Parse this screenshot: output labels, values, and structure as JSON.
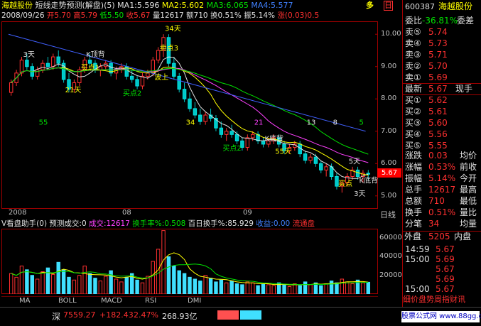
{
  "title": {
    "name": "海越股份",
    "indicator": "短线走势预测(解盘)(5)",
    "ma1": "MA1:5.596",
    "ma2": "MA2:5.602",
    "ma3": "MA3:6.065",
    "ma4": "MA4:5.577",
    "dir": "多",
    "day_label": "日"
  },
  "info": {
    "date": "2008/09/26",
    "open": "开5.70",
    "high": "高5.79",
    "low": "低5.50",
    "close": "收5.67",
    "volume": "量12617",
    "amount": "额710",
    "turnover": "换0.51%",
    "amplitude": "振5.14%",
    "change": "涨(0.03)0.5"
  },
  "price_axis": [
    "10.00",
    "9.00",
    "8.00",
    "7.00",
    "6.00",
    "5.00"
  ],
  "current_price": "5.67",
  "annotations": [
    {
      "text": "3天",
      "cls": "wht"
    },
    {
      "text": "21天",
      "cls": "yel"
    },
    {
      "text": "34天",
      "cls": "yel"
    },
    {
      "text": "K顶背",
      "cls": "wht"
    },
    {
      "text": "波上",
      "cls": "yel"
    },
    {
      "text": "K底背",
      "cls": "wht"
    },
    {
      "text": "55天",
      "cls": "yel"
    },
    {
      "text": "5天",
      "cls": "wht"
    },
    {
      "text": "K底背",
      "cls": "wht"
    },
    {
      "text": "3天",
      "cls": "wht"
    },
    {
      "text": "55",
      "cls": "grn"
    },
    {
      "text": "34",
      "cls": "yel"
    },
    {
      "text": "21",
      "cls": "mag"
    },
    {
      "text": "13",
      "cls": "wht"
    },
    {
      "text": "8",
      "cls": "wht"
    },
    {
      "text": "5",
      "cls": "grn"
    },
    {
      "text": "买点1",
      "cls": "yel"
    },
    {
      "text": "买点2",
      "cls": "grn"
    },
    {
      "text": "卖点3",
      "cls": "yel"
    },
    {
      "text": "买点2",
      "cls": "grn"
    },
    {
      "text": "买点",
      "cls": "yel"
    }
  ],
  "time_axis": [
    "2008",
    "08",
    "09",
    "日线"
  ],
  "volume_header": {
    "name": "V看盘助手(0)",
    "pred": "预测成交:0",
    "vol": "成交:12617",
    "turn": "换手率%:0.508",
    "hundred": "百日换手%:85.929",
    "gain": "收益:0.00",
    "flow": "流通盘"
  },
  "volume_axis": [
    "60000",
    "40000",
    "20000"
  ],
  "tabs": [
    "MA",
    "BOLL",
    "MACD",
    "RSI",
    "DMI"
  ],
  "index_bar": {
    "name": "深",
    "value": "7559.27",
    "change": "+182.43",
    "pct": "2.47%",
    "amount": "268.93亿"
  },
  "watermark": "股票公式网 www.88gg.com",
  "right_panel": {
    "code": "600387",
    "name": "海越股份",
    "ratio_label": "委比",
    "ratio": "-36.81%",
    "diff_label": "委差",
    "sells": [
      {
        "label": "卖⑤",
        "price": "5.74"
      },
      {
        "label": "卖④",
        "price": "5.73"
      },
      {
        "label": "卖③",
        "price": "5.71"
      },
      {
        "label": "卖②",
        "price": "5.70"
      },
      {
        "label": "卖①",
        "price": "5.69"
      }
    ],
    "latest_label": "最新",
    "latest": "5.67",
    "xianshou": "现手",
    "buys": [
      {
        "label": "买①",
        "price": "5.62"
      },
      {
        "label": "买②",
        "price": "5.61"
      },
      {
        "label": "买③",
        "price": "5.60"
      },
      {
        "label": "买④",
        "price": "5.56"
      },
      {
        "label": "买⑤",
        "price": "5.55"
      }
    ],
    "stats": [
      {
        "l": "涨跌",
        "v": "0.03",
        "r": "均价"
      },
      {
        "l": "涨幅",
        "v": "0.53%",
        "r": "前收"
      },
      {
        "l": "振幅",
        "v": "5.14%",
        "r": "今开"
      },
      {
        "l": "总手",
        "v": "12617",
        "r": "最高"
      },
      {
        "l": "总额",
        "v": "710",
        "r": "最低"
      },
      {
        "l": "换手",
        "v": "0.51%",
        "r": "量比"
      },
      {
        "l": "分笔",
        "v": "34",
        "r": "均量"
      }
    ],
    "outer_label": "外盘",
    "outer": "5205",
    "inner_label": "内盘",
    "ticks": [
      {
        "t": "14:59",
        "p": "5.67"
      },
      {
        "t": "15:00",
        "p": "5.69"
      },
      {
        "t": "",
        "p": "5.67"
      },
      {
        "t": "",
        "p": "5.69"
      },
      {
        "t": "15:00",
        "p": "5.67"
      }
    ],
    "bottom_tabs": "细价盘势周指财讯"
  },
  "chart_data": {
    "type": "bar",
    "title": "",
    "candles": [
      [
        8.2,
        8.6,
        8.1,
        8.5
      ],
      [
        8.5,
        8.9,
        8.4,
        8.8
      ],
      [
        8.8,
        9.3,
        8.7,
        9.2
      ],
      [
        9.2,
        9.4,
        8.9,
        9.0
      ],
      [
        9.0,
        9.1,
        8.6,
        8.7
      ],
      [
        8.7,
        9.0,
        8.6,
        8.9
      ],
      [
        8.9,
        9.2,
        8.8,
        9.1
      ],
      [
        9.1,
        9.3,
        8.9,
        9.0
      ],
      [
        9.0,
        9.4,
        8.9,
        9.3
      ],
      [
        9.3,
        9.5,
        9.0,
        9.1
      ],
      [
        9.1,
        9.2,
        8.5,
        8.6
      ],
      [
        8.6,
        8.8,
        8.2,
        8.3
      ],
      [
        8.3,
        8.6,
        8.2,
        8.5
      ],
      [
        8.5,
        9.0,
        8.4,
        8.9
      ],
      [
        8.9,
        9.3,
        8.8,
        9.2
      ],
      [
        9.2,
        9.4,
        9.0,
        9.1
      ],
      [
        9.1,
        9.2,
        8.8,
        8.9
      ],
      [
        8.9,
        9.1,
        8.7,
        9.0
      ],
      [
        9.0,
        9.2,
        8.9,
        9.1
      ],
      [
        9.1,
        9.2,
        8.7,
        8.8
      ],
      [
        8.8,
        9.0,
        8.6,
        8.9
      ],
      [
        8.9,
        9.1,
        8.8,
        9.0
      ],
      [
        9.0,
        9.1,
        8.6,
        8.7
      ],
      [
        8.7,
        8.9,
        8.5,
        8.6
      ],
      [
        8.6,
        8.7,
        8.3,
        8.4
      ],
      [
        8.4,
        8.8,
        8.3,
        8.7
      ],
      [
        8.7,
        8.9,
        8.6,
        8.8
      ],
      [
        8.8,
        9.3,
        8.7,
        9.2
      ],
      [
        9.2,
        9.6,
        9.1,
        9.5
      ],
      [
        9.5,
        10.0,
        9.3,
        9.9
      ],
      [
        9.9,
        10.0,
        9.0,
        9.1
      ],
      [
        9.1,
        9.3,
        8.6,
        8.7
      ],
      [
        8.7,
        8.8,
        8.2,
        8.3
      ],
      [
        8.3,
        8.5,
        7.9,
        8.0
      ],
      [
        8.0,
        8.2,
        7.6,
        7.7
      ],
      [
        7.7,
        7.9,
        7.4,
        7.5
      ],
      [
        7.5,
        7.7,
        7.2,
        7.3
      ],
      [
        7.3,
        7.6,
        7.2,
        7.5
      ],
      [
        7.5,
        7.7,
        7.3,
        7.4
      ],
      [
        7.4,
        7.5,
        7.0,
        7.1
      ],
      [
        7.1,
        7.3,
        6.8,
        6.9
      ],
      [
        6.9,
        7.1,
        6.7,
        7.0
      ],
      [
        7.0,
        7.2,
        6.8,
        6.9
      ],
      [
        6.9,
        7.0,
        6.6,
        6.7
      ],
      [
        6.7,
        6.8,
        6.4,
        6.5
      ],
      [
        6.5,
        6.9,
        6.4,
        6.8
      ],
      [
        6.8,
        7.0,
        6.7,
        6.9
      ],
      [
        6.9,
        7.0,
        6.6,
        6.7
      ],
      [
        6.7,
        6.8,
        6.5,
        6.6
      ],
      [
        6.6,
        6.8,
        6.5,
        6.7
      ],
      [
        6.7,
        6.9,
        6.6,
        6.8
      ],
      [
        6.8,
        6.9,
        6.5,
        6.6
      ],
      [
        6.6,
        6.7,
        6.3,
        6.4
      ],
      [
        6.4,
        6.6,
        6.3,
        6.5
      ],
      [
        6.5,
        6.7,
        6.4,
        6.6
      ],
      [
        6.6,
        6.7,
        6.2,
        6.3
      ],
      [
        6.3,
        6.4,
        6.0,
        6.1
      ],
      [
        6.1,
        6.3,
        6.0,
        6.2
      ],
      [
        6.2,
        6.3,
        5.9,
        6.0
      ],
      [
        6.0,
        6.1,
        5.7,
        5.8
      ],
      [
        5.8,
        6.0,
        5.6,
        5.9
      ],
      [
        5.9,
        6.0,
        5.5,
        5.6
      ],
      [
        5.6,
        5.7,
        5.2,
        5.3
      ],
      [
        5.3,
        5.5,
        5.1,
        5.4
      ],
      [
        5.4,
        5.7,
        5.3,
        5.6
      ],
      [
        5.6,
        5.9,
        5.5,
        5.8
      ],
      [
        5.8,
        5.9,
        5.5,
        5.6
      ],
      [
        5.6,
        5.8,
        5.4,
        5.7
      ],
      [
        5.7,
        5.8,
        5.5,
        5.67
      ]
    ],
    "volumes": [
      22000,
      18000,
      30000,
      26000,
      20000,
      16000,
      24000,
      28000,
      21000,
      34000,
      26000,
      18000,
      15000,
      20000,
      30000,
      22000,
      17000,
      14000,
      19000,
      25000,
      16000,
      13000,
      18000,
      22000,
      15000,
      12000,
      19000,
      35000,
      48000,
      68000,
      40000,
      30000,
      25000,
      22000,
      18000,
      16000,
      14000,
      20000,
      17000,
      13000,
      15000,
      12000,
      14000,
      11000,
      10000,
      13000,
      12000,
      9000,
      11000,
      10000,
      9000,
      12000,
      10000,
      8000,
      11000,
      9000,
      13000,
      10000,
      12000,
      9000,
      11000,
      14000,
      12000,
      16000,
      13000,
      11000,
      15000,
      12000,
      12617
    ],
    "ylim": [
      4.6,
      10.4
    ],
    "vol_max": 70000
  }
}
